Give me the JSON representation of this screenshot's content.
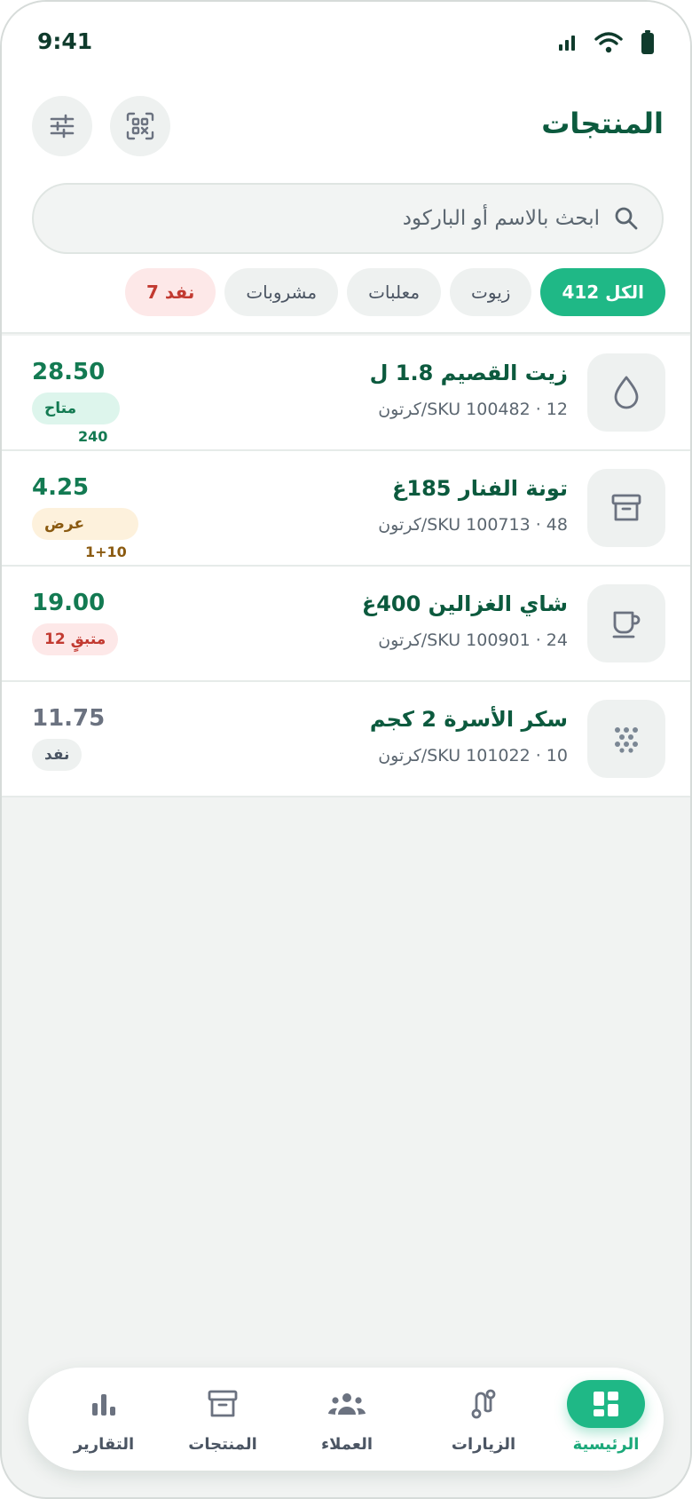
{
  "status_bar": {
    "time": "9:41"
  },
  "header": {
    "title": "المنتجات"
  },
  "search": {
    "placeholder": "ابحث بالاسم أو الباركود"
  },
  "chips": [
    {
      "label": "الكل 412",
      "active": true
    },
    {
      "label": "زيوت"
    },
    {
      "label": "معلبات"
    },
    {
      "label": "مشروبات"
    },
    {
      "label": "نفد 7",
      "state": "out"
    }
  ],
  "products": [
    {
      "name": "زيت القصيم 1.8 ل",
      "meta": "SKU 100482 · 12/كرتون",
      "price": "28.50",
      "badge": "متاح",
      "badge_sub": "240",
      "icon": "drop-icon"
    },
    {
      "name": "تونة الفنار 185غ",
      "meta": "SKU 100713 · 48/كرتون",
      "price": "4.25",
      "badge": "عرض",
      "badge_sub": "1+10",
      "icon": "box-icon"
    },
    {
      "name": "شاي الغزالين 400غ",
      "meta": "SKU 100901 · 24/كرتون",
      "price": "19.00",
      "badge": "متبقٍ 12",
      "icon": "cup-icon"
    },
    {
      "name": "سكر الأسرة 2 كجم",
      "meta": "SKU 101022 · 10/كرتون",
      "price": "11.75",
      "badge": "نفد",
      "icon": "dots-icon"
    }
  ],
  "nav": [
    {
      "label": "الرئيسية",
      "icon": "dashboard-icon",
      "active": true
    },
    {
      "label": "الزيارات",
      "icon": "route-icon"
    },
    {
      "label": "العملاء",
      "icon": "users-icon"
    },
    {
      "label": "المنتجات",
      "icon": "archive-icon"
    },
    {
      "label": "التقارير",
      "icon": "bar-chart-icon"
    }
  ],
  "colors": {
    "brand": "#1fb886",
    "title": "#0c5a3e",
    "danger": "#c23a31",
    "warning": "#8a5a10"
  }
}
